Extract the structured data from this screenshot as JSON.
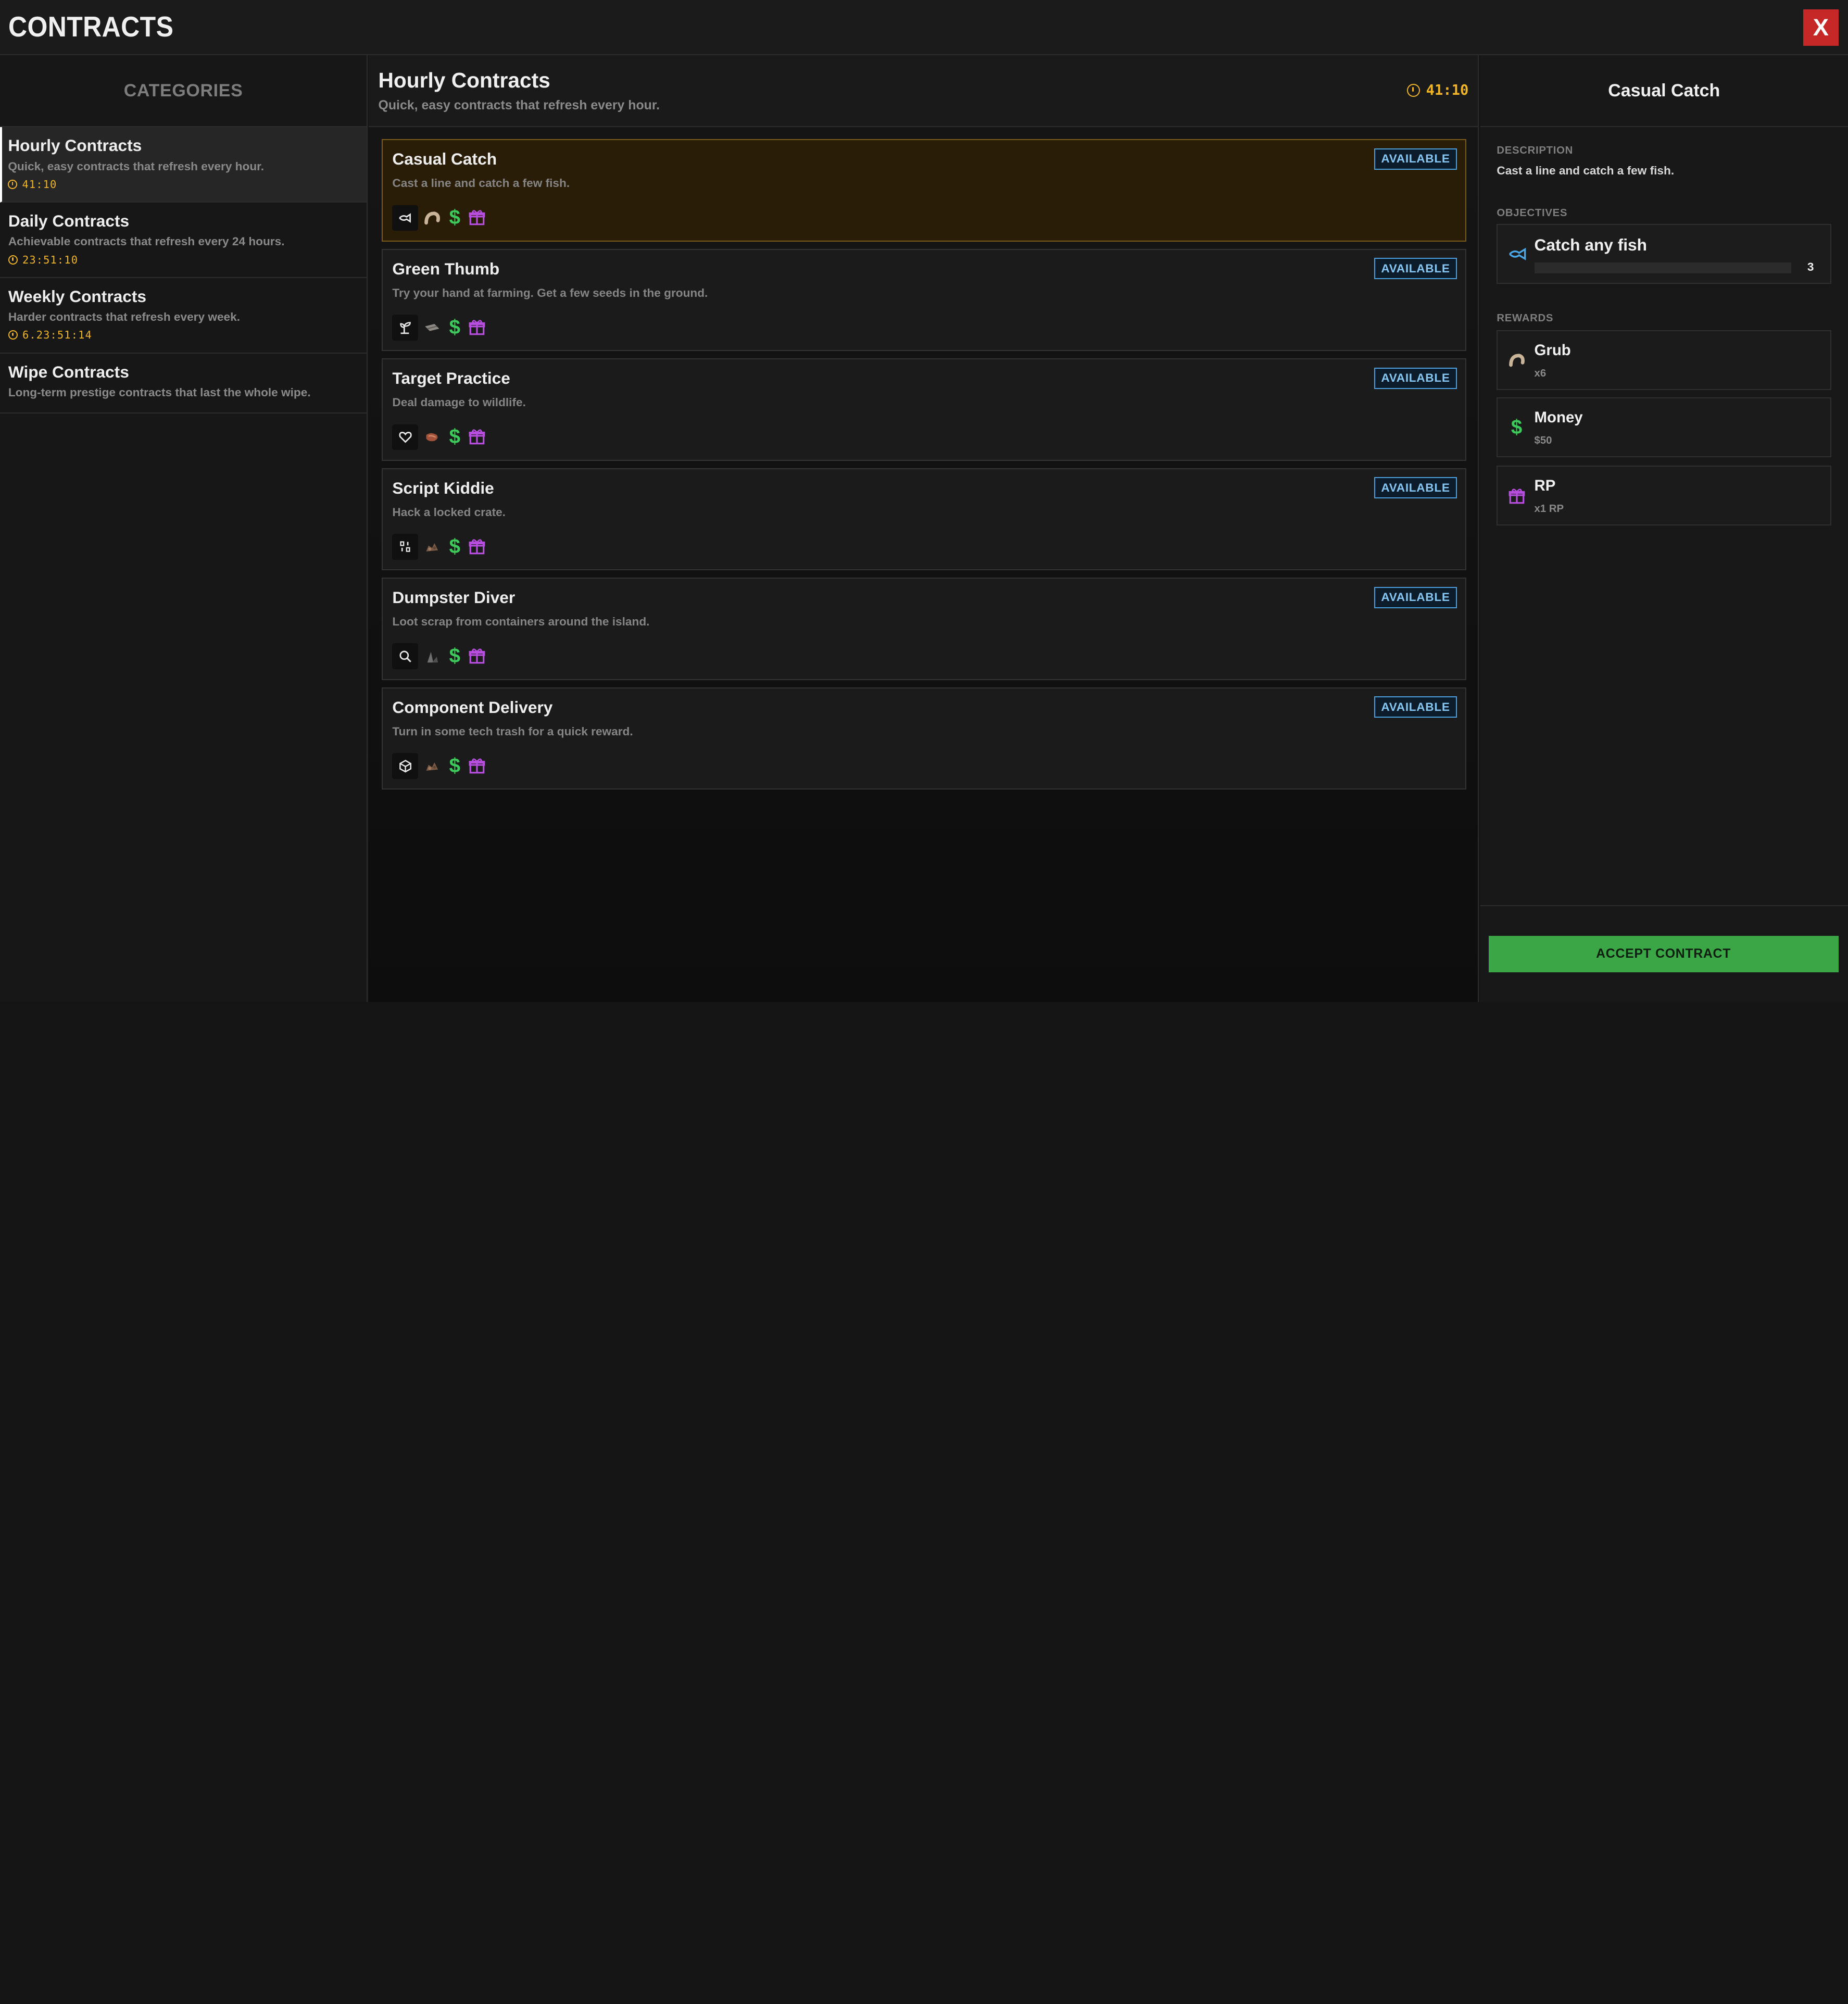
{
  "app": {
    "title": "CONTRACTS",
    "close_label": "X"
  },
  "sidebar": {
    "heading": "CATEGORIES",
    "items": [
      {
        "title": "Hourly Contracts",
        "desc": "Quick, easy contracts that refresh every hour.",
        "timer": "41:10"
      },
      {
        "title": "Daily Contracts",
        "desc": "Achievable contracts that refresh every 24 hours.",
        "timer": "23:51:10"
      },
      {
        "title": "Weekly Contracts",
        "desc": "Harder contracts that refresh every week.",
        "timer": "6.23:51:14"
      },
      {
        "title": "Wipe Contracts",
        "desc": "Long-term prestige contracts that last the whole wipe."
      }
    ]
  },
  "main": {
    "title": "Hourly Contracts",
    "subtitle": "Quick, easy contracts that refresh every hour.",
    "timer": "41:10",
    "contracts": [
      {
        "title": "Casual Catch",
        "desc": "Cast a line and catch a few fish.",
        "status": "AVAILABLE",
        "objective_icon": "fish-icon",
        "item_icon": "grub-icon",
        "selected": true
      },
      {
        "title": "Green Thumb",
        "desc": "Try your hand at farming. Get a few seeds in the ground.",
        "status": "AVAILABLE",
        "objective_icon": "sprout-icon",
        "item_icon": "cloth-icon"
      },
      {
        "title": "Target Practice",
        "desc": "Deal damage to wildlife.",
        "status": "AVAILABLE",
        "objective_icon": "heart-icon",
        "item_icon": "meat-icon"
      },
      {
        "title": "Script Kiddie",
        "desc": "Hack a locked crate.",
        "status": "AVAILABLE",
        "objective_icon": "code-icon",
        "item_icon": "scrap-pile-icon"
      },
      {
        "title": "Dumpster Diver",
        "desc": "Loot scrap from containers around the island.",
        "status": "AVAILABLE",
        "objective_icon": "magnifier-icon",
        "item_icon": "metal-fragments-icon"
      },
      {
        "title": "Component Delivery",
        "desc": "Turn in some tech trash for a quick reward.",
        "status": "AVAILABLE",
        "objective_icon": "box-icon",
        "item_icon": "scrap-pile-icon"
      }
    ],
    "money_symbol": "$"
  },
  "detail": {
    "title": "Casual Catch",
    "description_label": "DESCRIPTION",
    "description": "Cast a line and catch a few fish.",
    "objectives_label": "OBJECTIVES",
    "objective": {
      "name": "Catch any fish",
      "count": "3",
      "progress": 0
    },
    "rewards_label": "REWARDS",
    "rewards": [
      {
        "name": "Grub",
        "sub": "x6",
        "icon": "grub-icon"
      },
      {
        "name": "Money",
        "sub": "$50",
        "icon": "dollar-icon"
      },
      {
        "name": "RP",
        "sub": "x1 RP",
        "icon": "gift-icon"
      }
    ],
    "accept_label": "ACCEPT CONTRACT"
  },
  "colors": {
    "accent_gold": "#f0b429",
    "available_blue": "#4a9fdc",
    "money_green": "#3ec95c",
    "gift_purple": "#b84ee0",
    "close_red": "#c62828",
    "accept_green": "#3aa646"
  }
}
